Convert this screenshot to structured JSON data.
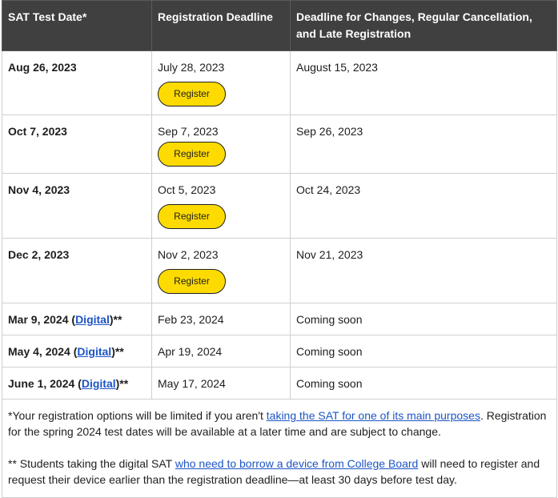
{
  "table": {
    "headers": [
      "SAT Test Date*",
      "Registration Deadline",
      "Deadline for Changes, Regular Cancellation, and Late Registration"
    ],
    "rows": [
      {
        "test_date": "Aug 26, 2023",
        "reg_deadline": "July 28, 2023",
        "change_deadline": "August 15, 2023",
        "button": "Register"
      },
      {
        "test_date": "Oct 7, 2023",
        "reg_deadline": "Sep 7, 2023",
        "change_deadline": "Sep 26, 2023",
        "button": "Register"
      },
      {
        "test_date": "Nov 4, 2023",
        "reg_deadline": "Oct 5, 2023",
        "change_deadline": "Oct 24, 2023",
        "button": "Register"
      },
      {
        "test_date": "Dec 2, 2023",
        "reg_deadline": "Nov 2, 2023",
        "change_deadline": "Nov 21, 2023",
        "button": "Register"
      },
      {
        "test_date": "Mar 9, 2024",
        "open_paren": " (",
        "digital_link": "Digital",
        "close_mark": ")**",
        "reg_deadline": "Feb 23, 2024",
        "change_deadline": "Coming soon"
      },
      {
        "test_date": "May 4, 2024",
        "open_paren": " (",
        "digital_link": "Digital",
        "close_mark": ")**",
        "reg_deadline": "Apr 19, 2024",
        "change_deadline": "Coming soon"
      },
      {
        "test_date": "June 1, 2024",
        "open_paren": " (",
        "digital_link": "Digital",
        "close_mark": ")**",
        "reg_deadline": "May 17, 2024",
        "change_deadline": "Coming soon"
      }
    ]
  },
  "notes": {
    "note1_pre": "*Your registration options will be limited if you aren't ",
    "note1_link": "taking the SAT for one of its main purposes",
    "note1_post": ". Registration for the spring 2024 test dates will be available at a later time and are subject to change.",
    "note2_pre": "** Students taking the digital SAT ",
    "note2_link": "who need to borrow a device from College Board",
    "note2_post": " will need to register and request their device earlier than the registration deadline—at least 30 days before test day."
  },
  "colors": {
    "header_bg": "#404040",
    "button_bg": "#fedb00",
    "link": "#1c55c6",
    "border": "#cfcfcf"
  }
}
